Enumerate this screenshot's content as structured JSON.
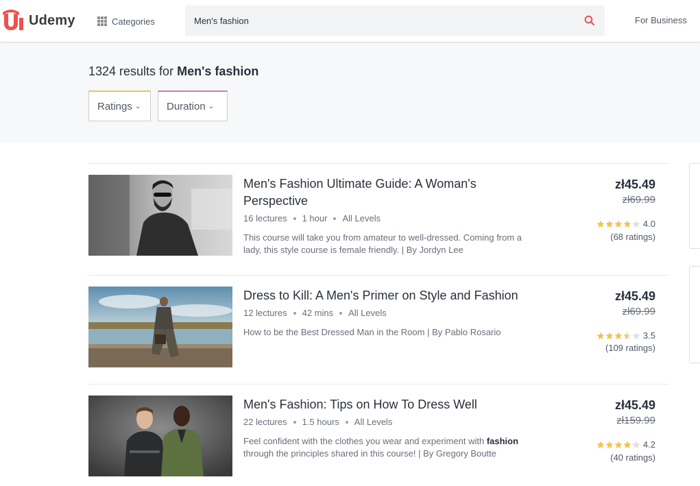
{
  "header": {
    "logo_text": "Udemy",
    "categories_label": "Categories",
    "search_value": "Men's fashion",
    "for_business_label": "For Business",
    "brand_color": "#ec5252"
  },
  "results": {
    "count_prefix": "1324 results for ",
    "query": "Men's fashion"
  },
  "filters": {
    "ratings_label": "Ratings",
    "duration_label": "Duration"
  },
  "courses": [
    {
      "title_line1": "Men's Fashion Ultimate Guide: A Woman's",
      "title_line2": "Perspective",
      "lectures": "16 lectures",
      "duration": "1 hour",
      "level": "All Levels",
      "desc_line1": "This course will take you from amateur to well-dressed. Coming from a",
      "desc_line2": "lady, this style course is female friendly. | By Jordyn Lee",
      "price": "zł45.49",
      "old_price": "zł69.99",
      "rating": "4.0",
      "rating_value": 4.0,
      "rating_count": "(68 ratings)"
    },
    {
      "title_line1": "Dress to Kill: A Men's Primer on Style and Fashion",
      "lectures": "12 lectures",
      "duration": "42 mins",
      "level": "All Levels",
      "desc_line1": "How to be the Best Dressed Man in the Room | By Pablo Rosario",
      "price": "zł45.49",
      "old_price": "zł69.99",
      "rating": "3.5",
      "rating_value": 3.5,
      "rating_count": "(109 ratings)"
    },
    {
      "title_line1": "Men's Fashion: Tips on How To Dress Well",
      "lectures": "22 lectures",
      "duration": "1.5 hours",
      "level": "All Levels",
      "desc_line1_a": "Feel confident with the clothes you wear and experiment with ",
      "desc_line1_b": "fashion",
      "desc_line2": "through the principles shared in this course! | By Gregory Boutte",
      "price": "zł45.49",
      "old_price": "zł159.99",
      "rating": "4.2",
      "rating_value": 4.2,
      "rating_count": "(40 ratings)"
    }
  ],
  "colors": {
    "star_filled": "#f4c150",
    "star_empty": "#dedfe0",
    "search_icon": "#ec5252"
  }
}
